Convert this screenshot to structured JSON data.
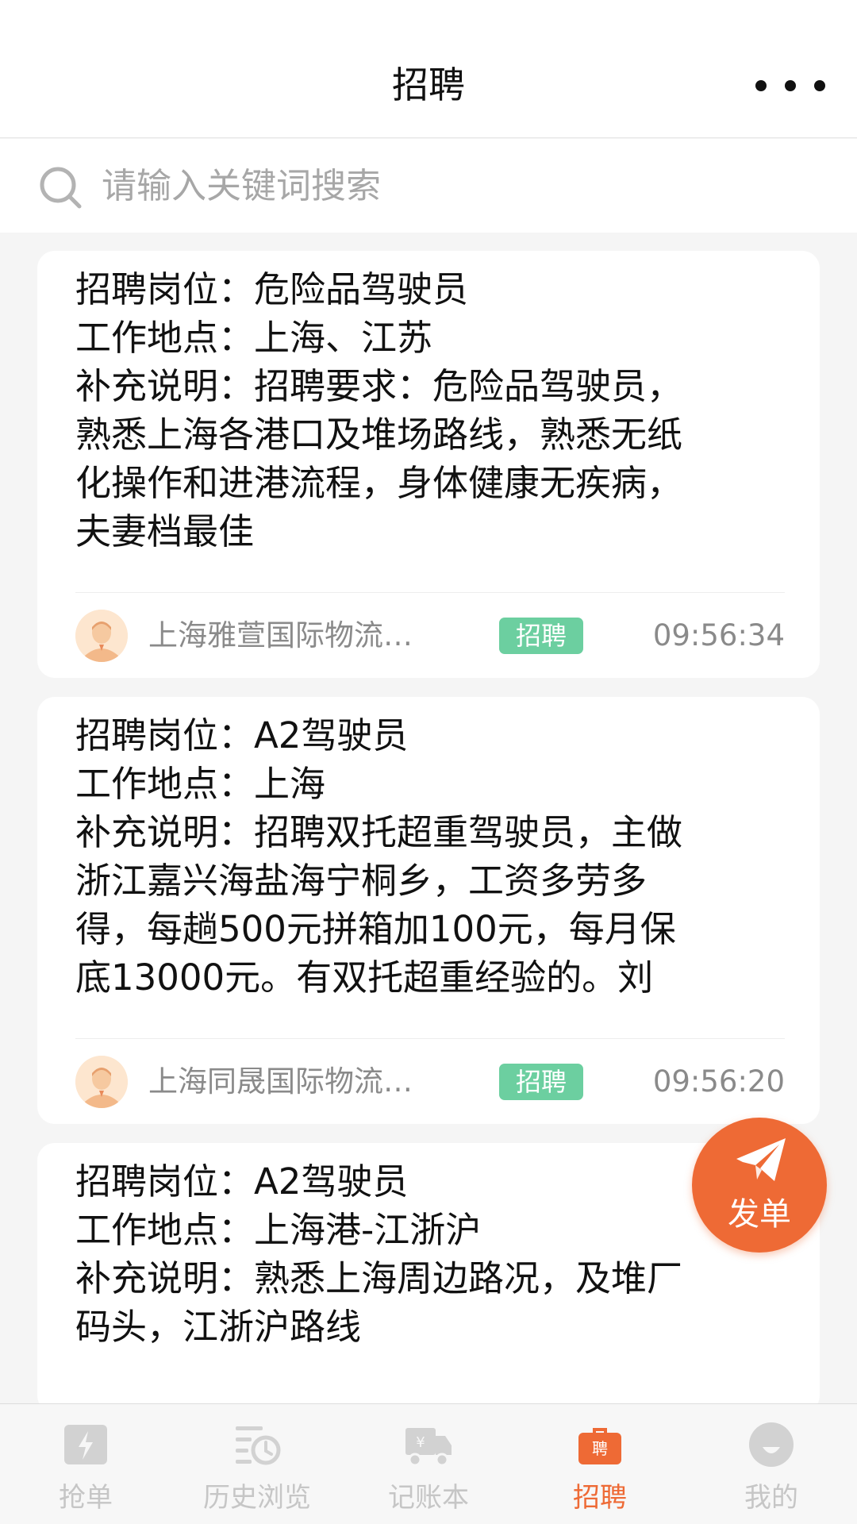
{
  "header": {
    "title": "招聘"
  },
  "search": {
    "placeholder": "请输入关键词搜索"
  },
  "posts": [
    {
      "lines": [
        "招聘岗位：危险品驾驶员",
        "工作地点：上海、江苏",
        "补充说明：招聘要求：危险品驾驶员，",
        "熟悉上海各港口及堆场路线，熟悉无纸",
        "化操作和进港流程，身体健康无疾病，",
        "夫妻档最佳"
      ],
      "company": "上海雅萱国际物流…",
      "tag": "招聘",
      "time": "09:56:34"
    },
    {
      "lines": [
        "招聘岗位：A2驾驶员",
        "工作地点：上海",
        "补充说明：招聘双托超重驾驶员，主做",
        "浙江嘉兴海盐海宁桐乡，工资多劳多",
        "得，每趟500元拼箱加100元，每月保",
        "底13000元。有双托超重经验的。刘"
      ],
      "company": "上海同晟国际物流…",
      "tag": "招聘",
      "time": "09:56:20"
    },
    {
      "lines": [
        "招聘岗位：A2驾驶员",
        "工作地点：上海港-江浙沪",
        "补充说明：熟悉上海周边路况，及堆厂",
        "码头，江浙沪路线"
      ]
    }
  ],
  "fab": {
    "label": "发单"
  },
  "tabs": [
    {
      "label": "抢单",
      "icon": "grab-order-icon"
    },
    {
      "label": "历史浏览",
      "icon": "history-icon"
    },
    {
      "label": "记账本",
      "icon": "ledger-truck-icon"
    },
    {
      "label": "招聘",
      "icon": "recruit-bag-icon",
      "active": true
    },
    {
      "label": "我的",
      "icon": "profile-icon"
    }
  ],
  "colors": {
    "accent": "#ee6a35",
    "tag": "#6ccfa0",
    "inactive": "#c6c6c6"
  }
}
